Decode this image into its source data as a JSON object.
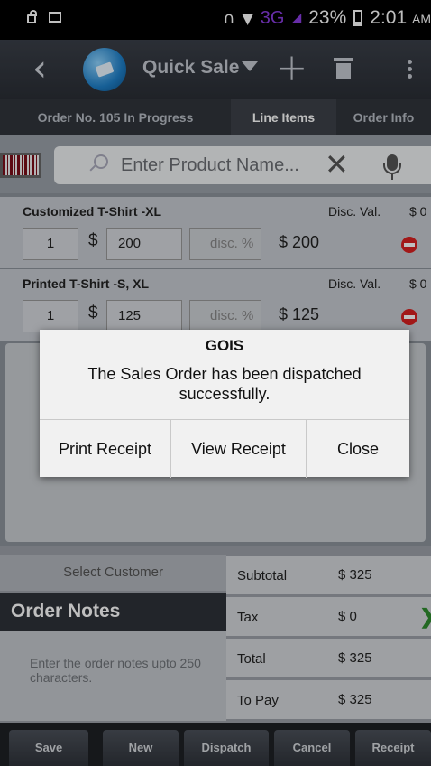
{
  "status_bar": {
    "network": "3G",
    "battery": "23%",
    "time": "2:01",
    "ampm": "AM"
  },
  "toolbar": {
    "title": "Quick Sale"
  },
  "tabs": [
    {
      "label": "Order No. 105 In Progress"
    },
    {
      "label": "Line Items"
    },
    {
      "label": "Order Info"
    }
  ],
  "search": {
    "placeholder": "Enter Product Name..."
  },
  "line_items": [
    {
      "name": "Customized T-Shirt -XL",
      "disc_label": "Disc. Val.",
      "disc_value": "$  0",
      "qty": "1",
      "currency": "$",
      "price": "200",
      "disc_placeholder": "disc. %",
      "total": "$ 200"
    },
    {
      "name": "Printed T-Shirt -S, XL",
      "disc_label": "Disc. Val.",
      "disc_value": "$  0",
      "qty": "1",
      "currency": "$",
      "price": "125",
      "disc_placeholder": "disc. %",
      "total": "$ 125"
    }
  ],
  "customer": {
    "select_label": "Select Customer"
  },
  "notes": {
    "header": "Order Notes",
    "placeholder": "Enter the order notes upto 250 characters."
  },
  "totals": [
    {
      "label": "Subtotal",
      "value": "$ 325"
    },
    {
      "label": "Tax",
      "value": "$ 0"
    },
    {
      "label": "Total",
      "value": "$ 325"
    },
    {
      "label": "To Pay",
      "value": "$ 325"
    }
  ],
  "actions": [
    {
      "label": "Save"
    },
    {
      "label": "New"
    },
    {
      "label": "Dispatch"
    },
    {
      "label": "Cancel"
    },
    {
      "label": "Receipt"
    }
  ],
  "dialog": {
    "title": "GOIS",
    "message": "The Sales Order has been dispatched successfully.",
    "buttons": [
      {
        "label": "Print Receipt"
      },
      {
        "label": "View Receipt"
      },
      {
        "label": "Close"
      }
    ]
  },
  "colors": {
    "toolbar": "#2f333a",
    "remove": "#d82020",
    "tax_arrow": "#2e8b2e",
    "network": "#8a3de0"
  }
}
